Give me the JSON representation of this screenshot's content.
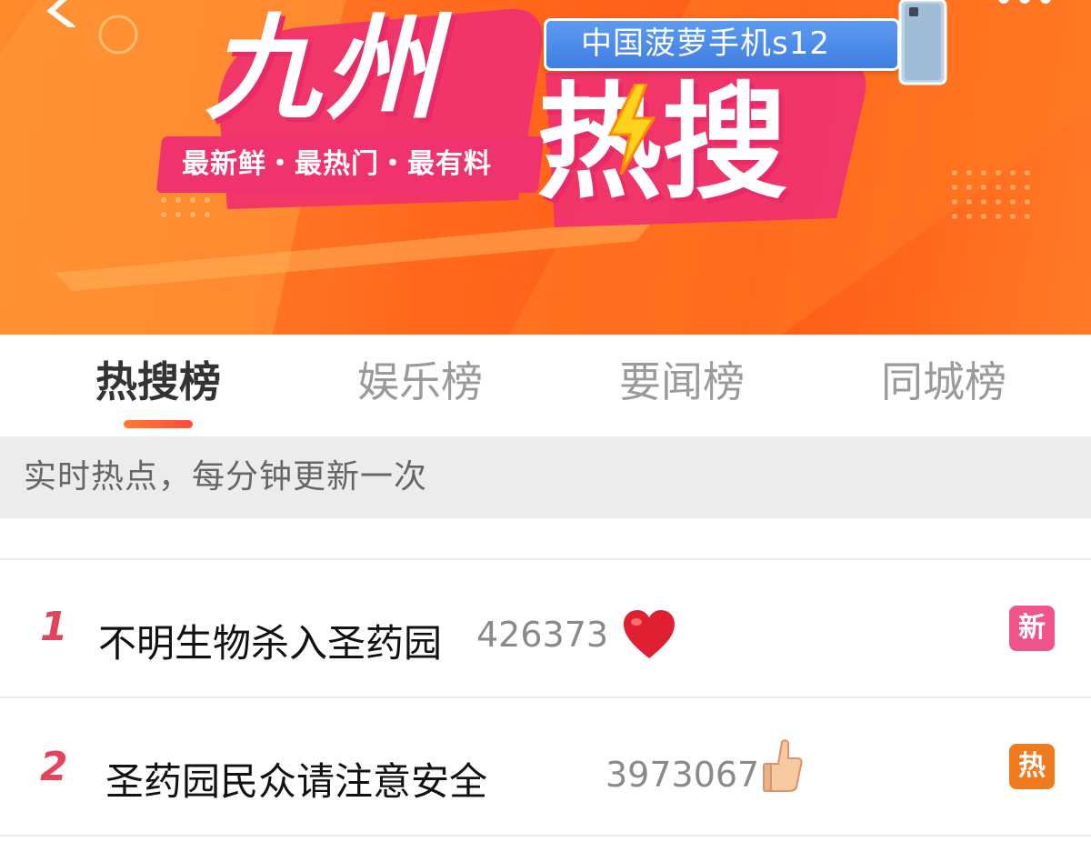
{
  "banner": {
    "brand_left": "九州",
    "brand_right": "热搜",
    "slogan": "最新鲜・最热门・最有料",
    "phone_pill": "中国菠萝手机s12",
    "colors": {
      "accent_pink": "#f0336e",
      "banner_orange": "#ff6a1e",
      "pill_blue": "#4a88ea"
    }
  },
  "tabs": [
    {
      "label": "热搜榜",
      "active": true
    },
    {
      "label": "娱乐榜",
      "active": false
    },
    {
      "label": "要闻榜",
      "active": false
    },
    {
      "label": "同城榜",
      "active": false
    }
  ],
  "notice": "实时热点，每分钟更新一次",
  "list": [
    {
      "rank": "1",
      "title": "不明生物杀入圣药园",
      "count": "426373",
      "emoji_icon": "heart-icon",
      "tag": "新",
      "tag_color": "#f0558a"
    },
    {
      "rank": "2",
      "title": "圣药园民众请注意安全",
      "count": "3973067",
      "emoji_icon": "thumbs-up-icon",
      "tag": "热",
      "tag_color": "#f07a1e"
    }
  ]
}
